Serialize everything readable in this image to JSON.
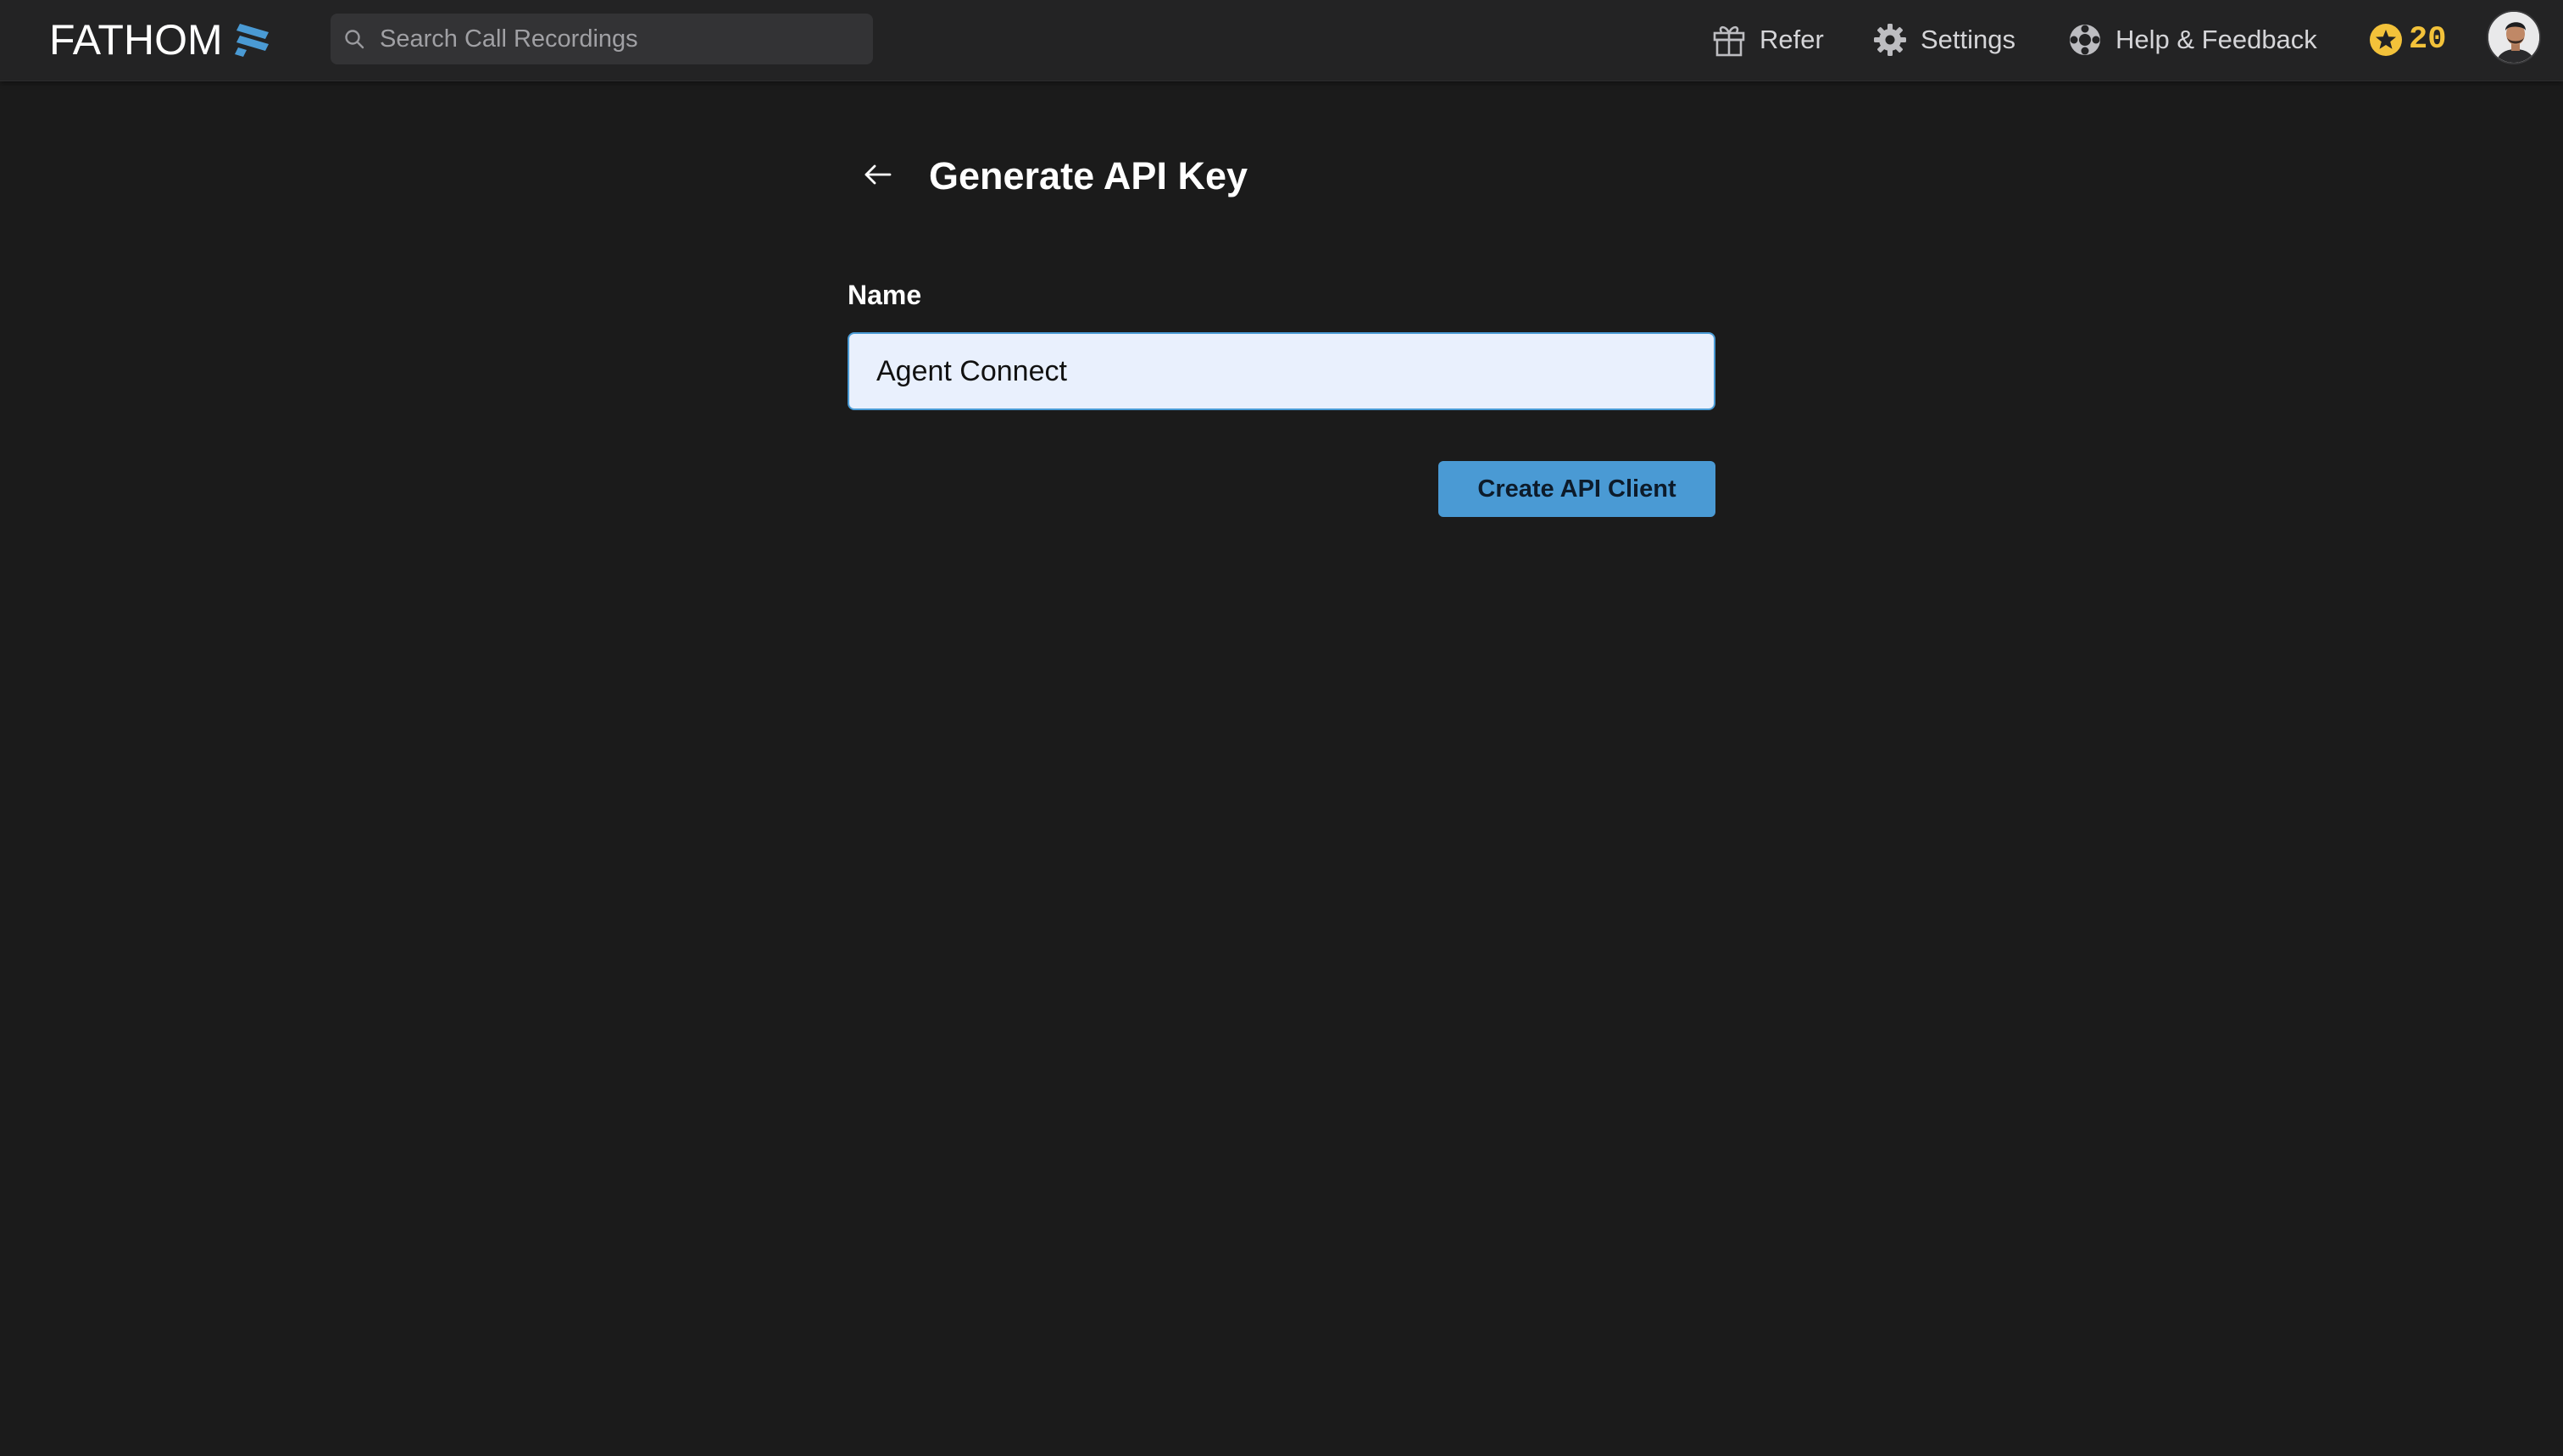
{
  "app": {
    "logo_text": "FATHOM",
    "brand_color": "#4a9ad4"
  },
  "header": {
    "search": {
      "placeholder": "Search Call Recordings",
      "value": ""
    },
    "nav": {
      "refer": {
        "label": "Refer",
        "icon": "gift-icon"
      },
      "settings": {
        "label": "Settings",
        "icon": "gear-icon"
      },
      "help": {
        "label": "Help & Feedback",
        "icon": "lifebuoy-icon"
      }
    },
    "credits": {
      "value": "20",
      "icon": "star-coin-icon",
      "color": "#f3c23a"
    },
    "avatar": {
      "icon": "user-avatar"
    }
  },
  "main": {
    "back_icon": "arrow-left-icon",
    "title": "Generate API Key",
    "form": {
      "name_label": "Name",
      "name_value": "Agent Connect",
      "submit_label": "Create API Client"
    }
  }
}
